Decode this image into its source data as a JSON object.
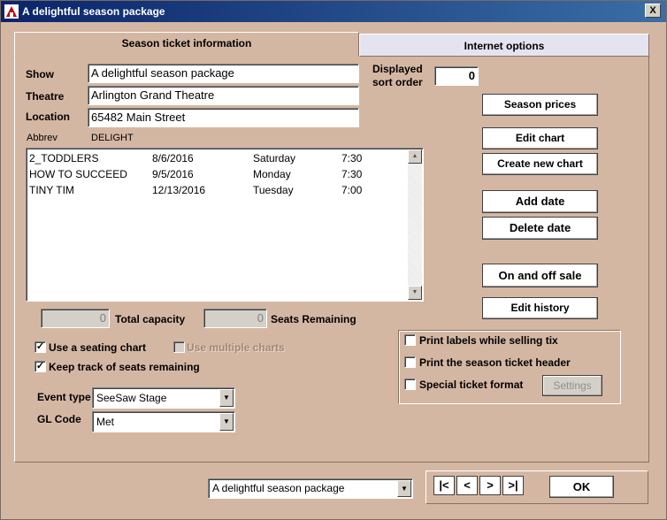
{
  "window": {
    "title": "A delightful season package",
    "close_glyph": "X"
  },
  "tabs": {
    "active": "Season ticket information",
    "inactive": "Internet options"
  },
  "form": {
    "show_label": "Show",
    "show_value": "A delightful season package",
    "theatre_label": "Theatre",
    "theatre_value": "Arlington Grand Theatre",
    "location_label": "Location",
    "location_value": "65482 Main Street",
    "abbrev_label": "Abbrev",
    "abbrev_value": "DELIGHT",
    "sort_label_1": "Displayed",
    "sort_label_2": "sort order",
    "sort_value": "0"
  },
  "events": [
    {
      "name": "2_TODDLERS",
      "date": "8/6/2016",
      "day": "Saturday",
      "time": "7:30"
    },
    {
      "name": "HOW TO SUCCEED",
      "date": "9/5/2016",
      "day": "Monday",
      "time": "7:30"
    },
    {
      "name": "TINY TIM",
      "date": "12/13/2016",
      "day": "Tuesday",
      "time": "7:00"
    }
  ],
  "capacity": {
    "total_value": "0",
    "total_label": "Total capacity",
    "remaining_value": "0",
    "remaining_label": "Seats Remaining"
  },
  "options": {
    "seating_chart": "Use a seating chart",
    "seating_chart_checked": true,
    "multiple_charts": "Use multiple charts",
    "multiple_charts_checked": false,
    "track_seats": "Keep track of seats remaining",
    "track_seats_checked": true,
    "check_glyph": "✓"
  },
  "event_type": {
    "label": "Event type",
    "value": "SeeSaw Stage"
  },
  "gl_code": {
    "label": "GL Code",
    "value": "Met"
  },
  "buttons": {
    "season_prices": "Season prices",
    "edit_chart": "Edit chart",
    "create_chart": "Create new chart",
    "add_date": "Add  date",
    "delete_date": "Delete date",
    "on_off_sale": "On and off sale",
    "edit_history": "Edit history",
    "settings": "Settings",
    "ok": "OK"
  },
  "print_options": {
    "labels": "Print labels while selling tix",
    "header": "Print the season ticket header",
    "special": "Special ticket format"
  },
  "footer": {
    "package_select": "A delightful season package",
    "first": "|<",
    "prev": "<",
    "next": ">",
    "last": ">|"
  },
  "colors": {
    "title_start": "#0a246a",
    "title_end": "#3a6ea5",
    "background": "#d4b7a3"
  }
}
